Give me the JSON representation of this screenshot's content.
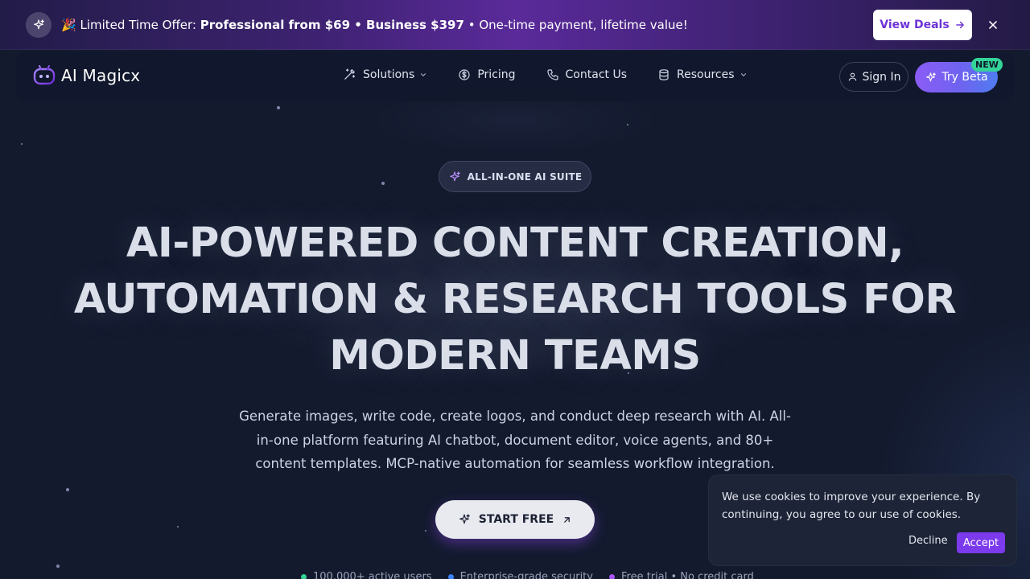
{
  "promo": {
    "emoji": "🎉",
    "lead": "Limited Time Offer:",
    "offer": "Professional from $69 • Business $397",
    "tail": "• One-time payment, lifetime value!",
    "cta_label": "View Deals"
  },
  "nav": {
    "logo_text": "AI Magicx",
    "links": [
      {
        "label": "Solutions"
      },
      {
        "label": "Pricing"
      },
      {
        "label": "Contact Us"
      },
      {
        "label": "Resources"
      }
    ],
    "signin_label": "Sign In",
    "trybeta_label": "Try Beta",
    "new_badge": "NEW"
  },
  "hero": {
    "chip_label": "ALL-IN-ONE AI SUITE",
    "title_lines": [
      "AI-POWERED CONTENT CREATION,",
      "AUTOMATION & RESEARCH TOOLS FOR",
      "MODERN TEAMS"
    ],
    "subtitle": "Generate images, write code, create logos, and conduct deep research with AI. All-in-one platform featuring AI chatbot, document editor, voice agents, and 80+ content templates. MCP-native automation for seamless workflow integration.",
    "cta_label": "START FREE",
    "trust": [
      {
        "label": "100,000+ active users",
        "color": "#34d399"
      },
      {
        "label": "Enterprise-grade security",
        "color": "#3b82f6"
      },
      {
        "label": "Free trial • No credit card",
        "color": "#a855f7"
      }
    ]
  },
  "cookie": {
    "message": "We use cookies to improve your experience. By continuing, you agree to our use of cookies.",
    "decline_label": "Decline",
    "accept_label": "Accept"
  },
  "colors": {
    "accent": "#7c3aed",
    "background": "#131a2e"
  }
}
